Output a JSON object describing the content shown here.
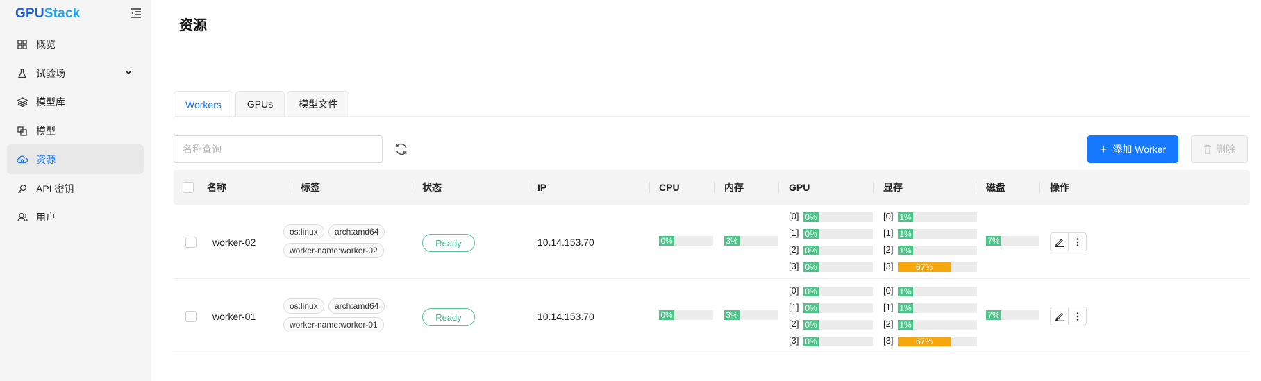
{
  "app": {
    "logo_part1": "GPU",
    "logo_part2": "Stack"
  },
  "sidebar": {
    "items": [
      {
        "label": "概览",
        "icon": "dashboard-grid-icon"
      },
      {
        "label": "试验场",
        "icon": "flask-icon"
      },
      {
        "label": "模型库",
        "icon": "layers-icon"
      },
      {
        "label": "模型",
        "icon": "models-icon"
      },
      {
        "label": "资源",
        "icon": "cloud-resources-icon"
      },
      {
        "label": "API 密钥",
        "icon": "key-icon"
      },
      {
        "label": "用户",
        "icon": "users-icon"
      }
    ],
    "active_index": 4
  },
  "page": {
    "title": "资源"
  },
  "tabs": [
    {
      "label": "Workers",
      "active": true
    },
    {
      "label": "GPUs",
      "active": false
    },
    {
      "label": "模型文件",
      "active": false
    }
  ],
  "toolbar": {
    "search_placeholder": "名称查询",
    "add_label": "添加 Worker",
    "delete_label": "删除"
  },
  "table": {
    "headers": [
      "名称",
      "标签",
      "状态",
      "IP",
      "CPU",
      "内存",
      "GPU",
      "显存",
      "磁盘",
      "操作"
    ],
    "rows": [
      {
        "name": "worker-02",
        "tags": [
          "os:linux",
          "arch:amd64",
          "worker-name:worker-02"
        ],
        "status": "Ready",
        "ip": "10.14.153.70",
        "cpu": "0%",
        "cpu_value": 0,
        "mem": "3%",
        "mem_value": 3,
        "gpu": [
          {
            "idx": "[0]",
            "label": "0%",
            "value": 0
          },
          {
            "idx": "[1]",
            "label": "0%",
            "value": 0
          },
          {
            "idx": "[2]",
            "label": "0%",
            "value": 0
          },
          {
            "idx": "[3]",
            "label": "0%",
            "value": 0
          }
        ],
        "vram": [
          {
            "idx": "[0]",
            "label": "1%",
            "value": 1
          },
          {
            "idx": "[1]",
            "label": "1%",
            "value": 1
          },
          {
            "idx": "[2]",
            "label": "1%",
            "value": 1
          },
          {
            "idx": "[3]",
            "label": "67%",
            "value": 67
          }
        ],
        "disk": "7%",
        "disk_value": 7
      },
      {
        "name": "worker-01",
        "tags": [
          "os:linux",
          "arch:amd64",
          "worker-name:worker-01"
        ],
        "status": "Ready",
        "ip": "10.14.153.70",
        "cpu": "0%",
        "cpu_value": 0,
        "mem": "3%",
        "mem_value": 3,
        "gpu": [
          {
            "idx": "[0]",
            "label": "0%",
            "value": 0
          },
          {
            "idx": "[1]",
            "label": "0%",
            "value": 0
          },
          {
            "idx": "[2]",
            "label": "0%",
            "value": 0
          },
          {
            "idx": "[3]",
            "label": "0%",
            "value": 0
          }
        ],
        "vram": [
          {
            "idx": "[0]",
            "label": "1%",
            "value": 1
          },
          {
            "idx": "[1]",
            "label": "1%",
            "value": 1
          },
          {
            "idx": "[2]",
            "label": "1%",
            "value": 1
          },
          {
            "idx": "[3]",
            "label": "67%",
            "value": 67
          }
        ],
        "disk": "7%",
        "disk_value": 7
      }
    ]
  },
  "colors": {
    "accent": "#1677ff",
    "ok": "#4fc38a",
    "warn": "#f5a70d"
  }
}
